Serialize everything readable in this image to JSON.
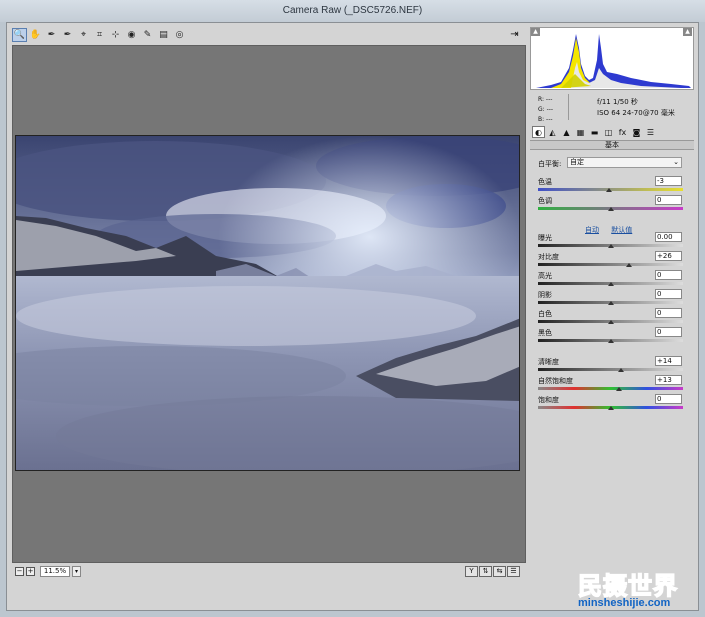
{
  "window": {
    "title": "Camera Raw (_DSC5726.NEF)"
  },
  "toolbar": {
    "tools": [
      {
        "icon": "zoom-icon",
        "glyph": "🔍",
        "active": true
      },
      {
        "icon": "hand-icon",
        "glyph": "✋",
        "active": false
      },
      {
        "icon": "white-balance-icon",
        "glyph": "✒",
        "active": false
      },
      {
        "icon": "color-sampler-icon",
        "glyph": "✒",
        "active": false
      },
      {
        "icon": "targeted-adjustment-icon",
        "glyph": "⌖",
        "active": false
      },
      {
        "icon": "crop-icon",
        "glyph": "⌗",
        "active": false
      },
      {
        "icon": "straighten-icon",
        "glyph": "⊹",
        "active": false
      },
      {
        "icon": "red-eye-icon",
        "glyph": "◉",
        "active": false
      },
      {
        "icon": "adjustment-brush-icon",
        "glyph": "✎",
        "active": false
      },
      {
        "icon": "graduated-filter-icon",
        "glyph": "▤",
        "active": false
      },
      {
        "icon": "radial-filter-icon",
        "glyph": "◎",
        "active": false
      }
    ],
    "fullscreen_glyph": "⇥"
  },
  "status": {
    "zoom_value": "11.5%",
    "minus_glyph": "−",
    "plus_glyph": "+",
    "dropdown_glyph": "▾",
    "view_buttons": [
      "Y",
      "⇅",
      "⇆",
      "☰"
    ]
  },
  "histogram": {
    "clip_left": "▲",
    "clip_right": "▲"
  },
  "info": {
    "r": "R:  ---",
    "g": "G:  ---",
    "b": "B:  ---",
    "exposure": "f/11   1/50 秒",
    "camera": "ISO 64   24-70@70 毫米"
  },
  "tabs": [
    "◐",
    "◭",
    "▲",
    "▦",
    "▬",
    "◫",
    "fx",
    "◙",
    "☰"
  ],
  "panel": {
    "title": "基本",
    "wb_label": "白平衡:",
    "wb_value": "自定",
    "auto_label": "自动",
    "default_label": "默认值",
    "sliders": [
      {
        "label": "色温",
        "value": "-3",
        "position": 0.49
      },
      {
        "label": "色调",
        "value": "0",
        "position": 0.5
      },
      {
        "label": "曝光",
        "value": "0.00",
        "position": 0.5
      },
      {
        "label": "对比度",
        "value": "+26",
        "position": 0.63
      },
      {
        "label": "高光",
        "value": "0",
        "position": 0.5
      },
      {
        "label": "阴影",
        "value": "0",
        "position": 0.5
      },
      {
        "label": "白色",
        "value": "0",
        "position": 0.5
      },
      {
        "label": "黑色",
        "value": "0",
        "position": 0.5
      },
      {
        "label": "清晰度",
        "value": "+14",
        "position": 0.57
      },
      {
        "label": "自然饱和度",
        "value": "+13",
        "position": 0.56
      },
      {
        "label": "饱和度",
        "value": "0",
        "position": 0.5
      }
    ]
  },
  "watermark": {
    "brand": "民摄世界",
    "url": "minsheshijie.com"
  },
  "colors": {
    "temp_track": "#4050c8",
    "tint_track": "#30b040",
    "sat_track": "#c83cc8"
  }
}
